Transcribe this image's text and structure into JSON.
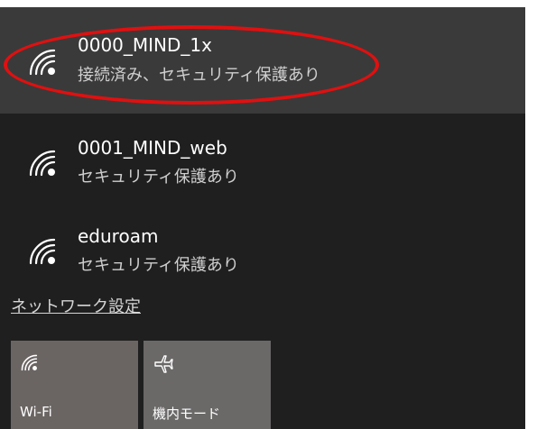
{
  "networks": [
    {
      "ssid": "0000_MIND_1x",
      "status": "接続済み、セキュリティ保護あり"
    },
    {
      "ssid": "0001_MIND_web",
      "status": "セキュリティ保護あり"
    },
    {
      "ssid": "eduroam",
      "status": "セキュリティ保護あり"
    }
  ],
  "settings_link": "ネットワーク設定",
  "tiles": {
    "wifi": {
      "label": "Wi-Fi",
      "icon": "wifi-icon"
    },
    "airplane": {
      "label": "機内モード",
      "icon": "airplane-icon"
    }
  },
  "colors": {
    "panel_bg": "#1f1f1f",
    "selected_bg": "#3a3a3a",
    "highlight_ellipse": "#e01010",
    "tile_bg": "#6b6868"
  }
}
